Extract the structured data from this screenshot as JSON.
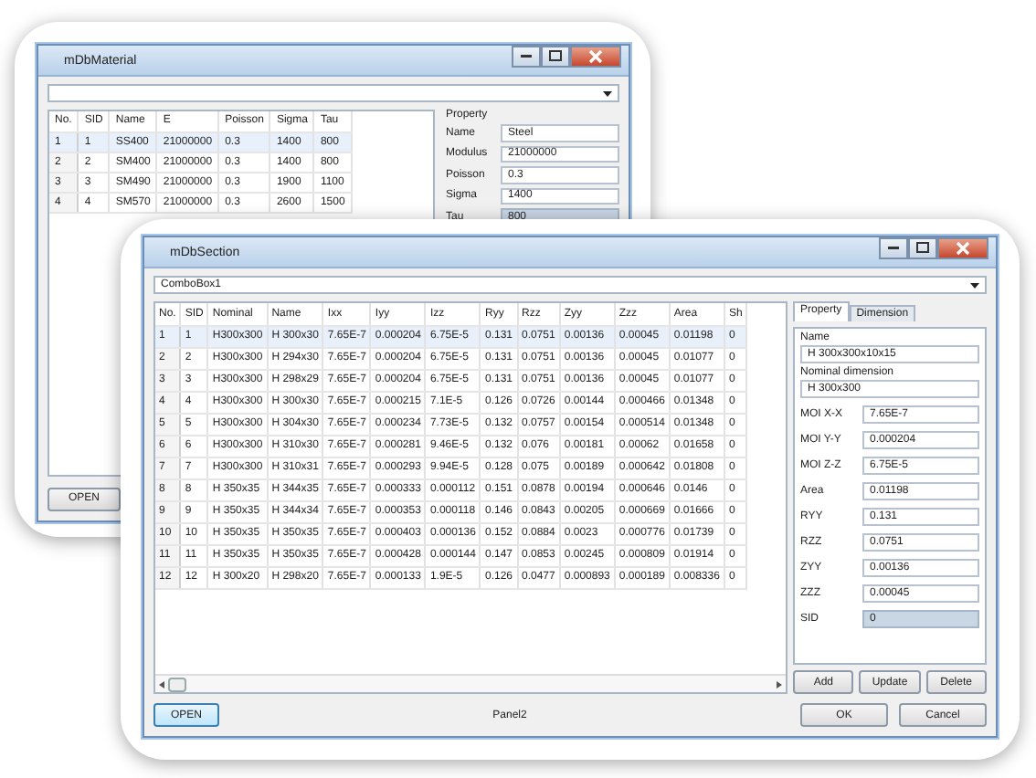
{
  "material_window": {
    "title": "mDbMaterial",
    "table": {
      "columns": [
        "No.",
        "SID",
        "Name",
        "E",
        "Poisson",
        "Sigma",
        "Tau"
      ],
      "rows": [
        {
          "selected": true,
          "cells": [
            "1",
            "1",
            "SS400",
            "21000000",
            "0.3",
            "1400",
            "800"
          ]
        },
        {
          "selected": false,
          "cells": [
            "2",
            "2",
            "SM400",
            "21000000",
            "0.3",
            "1400",
            "800"
          ]
        },
        {
          "selected": false,
          "cells": [
            "3",
            "3",
            "SM490",
            "21000000",
            "0.3",
            "1900",
            "1100"
          ]
        },
        {
          "selected": false,
          "cells": [
            "4",
            "4",
            "SM570",
            "21000000",
            "0.3",
            "2600",
            "1500"
          ]
        }
      ]
    },
    "property": {
      "title": "Property",
      "fields": [
        {
          "label": "Name",
          "value": "Steel",
          "disabled": false
        },
        {
          "label": "Modulus",
          "value": "21000000",
          "disabled": false
        },
        {
          "label": "Poisson",
          "value": "0.3",
          "disabled": false
        },
        {
          "label": "Sigma",
          "value": "1400",
          "disabled": false
        },
        {
          "label": "Tau",
          "value": "800",
          "disabled": true
        }
      ]
    },
    "open_button": "OPEN"
  },
  "section_window": {
    "title": "mDbSection",
    "combo": {
      "value": "ComboBox1"
    },
    "table": {
      "columns": [
        "No.",
        "SID",
        "Nominal",
        "Name",
        "Ixx",
        "Iyy",
        "Izz",
        "Ryy",
        "Rzz",
        "Zyy",
        "Zzz",
        "Area",
        "Sh"
      ],
      "rows": [
        {
          "selected": true,
          "cells": [
            "1",
            "1",
            "H300x300",
            "H 300x30",
            "7.65E-7",
            "0.000204",
            "6.75E-5",
            "0.131",
            "0.0751",
            "0.00136",
            "0.00045",
            "0.01198",
            "0"
          ]
        },
        {
          "selected": false,
          "cells": [
            "2",
            "2",
            "H300x300",
            "H 294x30",
            "7.65E-7",
            "0.000204",
            "6.75E-5",
            "0.131",
            "0.0751",
            "0.00136",
            "0.00045",
            "0.01077",
            "0"
          ]
        },
        {
          "selected": false,
          "cells": [
            "3",
            "3",
            "H300x300",
            "H 298x29",
            "7.65E-7",
            "0.000204",
            "6.75E-5",
            "0.131",
            "0.0751",
            "0.00136",
            "0.00045",
            "0.01077",
            "0"
          ]
        },
        {
          "selected": false,
          "cells": [
            "4",
            "4",
            "H300x300",
            "H 300x30",
            "7.65E-7",
            "0.000215",
            "7.1E-5",
            "0.126",
            "0.0726",
            "0.00144",
            "0.000466",
            "0.01348",
            "0"
          ]
        },
        {
          "selected": false,
          "cells": [
            "5",
            "5",
            "H300x300",
            "H 304x30",
            "7.65E-7",
            "0.000234",
            "7.73E-5",
            "0.132",
            "0.0757",
            "0.00154",
            "0.000514",
            "0.01348",
            "0"
          ]
        },
        {
          "selected": false,
          "cells": [
            "6",
            "6",
            "H300x300",
            "H 310x30",
            "7.65E-7",
            "0.000281",
            "9.46E-5",
            "0.132",
            "0.076",
            "0.00181",
            "0.00062",
            "0.01658",
            "0"
          ]
        },
        {
          "selected": false,
          "cells": [
            "7",
            "7",
            "H300x300",
            "H 310x31",
            "7.65E-7",
            "0.000293",
            "9.94E-5",
            "0.128",
            "0.075",
            "0.00189",
            "0.000642",
            "0.01808",
            "0"
          ]
        },
        {
          "selected": false,
          "cells": [
            "8",
            "8",
            "H 350x35",
            "H 344x35",
            "7.65E-7",
            "0.000333",
            "0.000112",
            "0.151",
            "0.0878",
            "0.00194",
            "0.000646",
            "0.0146",
            "0"
          ]
        },
        {
          "selected": false,
          "cells": [
            "9",
            "9",
            "H 350x35",
            "H 344x34",
            "7.65E-7",
            "0.000353",
            "0.000118",
            "0.146",
            "0.0843",
            "0.00205",
            "0.000669",
            "0.01666",
            "0"
          ]
        },
        {
          "selected": false,
          "cells": [
            "10",
            "10",
            "H 350x35",
            "H 350x35",
            "7.65E-7",
            "0.000403",
            "0.000136",
            "0.152",
            "0.0884",
            "0.0023",
            "0.000776",
            "0.01739",
            "0"
          ]
        },
        {
          "selected": false,
          "cells": [
            "11",
            "11",
            "H 350x35",
            "H 350x35",
            "7.65E-7",
            "0.000428",
            "0.000144",
            "0.147",
            "0.0853",
            "0.00245",
            "0.000809",
            "0.01914",
            "0"
          ]
        },
        {
          "selected": false,
          "cells": [
            "12",
            "12",
            "H 300x20",
            "H 298x20",
            "7.65E-7",
            "0.000133",
            "1.9E-5",
            "0.126",
            "0.0477",
            "0.000893",
            "0.000189",
            "0.008336",
            "0"
          ]
        }
      ]
    },
    "tabs": [
      {
        "label": "Property",
        "selected": true
      },
      {
        "label": "Dimension",
        "selected": false
      }
    ],
    "fields": [
      {
        "kind": "stacked",
        "label": "Name",
        "value": "H 300x300x10x15",
        "disabled": false
      },
      {
        "kind": "stacked",
        "label": "Nominal dimension",
        "value": "H 300x300",
        "disabled": false
      },
      {
        "kind": "inline",
        "label": "MOI X-X",
        "value": "7.65E-7",
        "disabled": false
      },
      {
        "kind": "inline",
        "label": "MOI Y-Y",
        "value": "0.000204",
        "disabled": false
      },
      {
        "kind": "inline",
        "label": "MOI Z-Z",
        "value": "6.75E-5",
        "disabled": false
      },
      {
        "kind": "inline",
        "label": "Area",
        "value": "0.01198",
        "disabled": false
      },
      {
        "kind": "inline",
        "label": "RYY",
        "value": "0.131",
        "disabled": false
      },
      {
        "kind": "inline",
        "label": "RZZ",
        "value": "0.0751",
        "disabled": false
      },
      {
        "kind": "inline",
        "label": "ZYY",
        "value": "0.00136",
        "disabled": false
      },
      {
        "kind": "inline",
        "label": "ZZZ",
        "value": "0.00045",
        "disabled": false
      },
      {
        "kind": "inline",
        "label": "SID",
        "value": "0",
        "disabled": true
      }
    ],
    "panel_buttons": [
      "Add",
      "Update",
      "Delete"
    ],
    "open_button": "OPEN",
    "status": "Panel2",
    "dialog_buttons": [
      "OK",
      "Cancel"
    ]
  }
}
